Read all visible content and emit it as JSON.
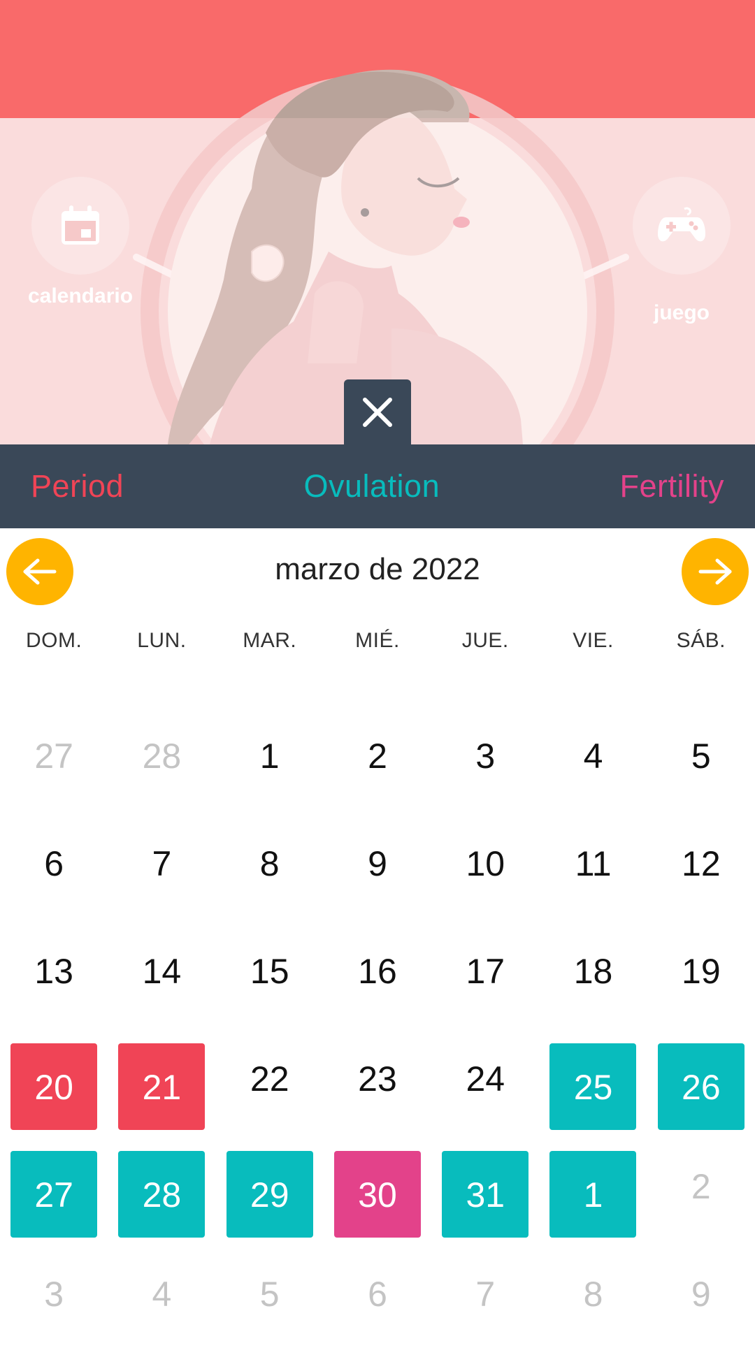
{
  "colors": {
    "header": "#f96a6a",
    "legend_bg": "#3a4858",
    "nav_button": "#ffb400",
    "period": "#f04456",
    "ovulation": "#08bcbd",
    "fertility": "#e3428a"
  },
  "features": {
    "calendar": {
      "label": "calendario",
      "icon": "calendar-icon"
    },
    "game": {
      "label": "juego",
      "icon": "gamepad-icon"
    }
  },
  "legend": {
    "period": "Period",
    "ovulation": "Ovulation",
    "fertility": "Fertility"
  },
  "calendar": {
    "month_title": "marzo de 2022",
    "weekdays": [
      "DOM.",
      "LUN.",
      "MAR.",
      "MIÉ.",
      "JUE.",
      "VIE.",
      "SÁB."
    ],
    "weeks": [
      [
        {
          "d": "27",
          "t": "muted"
        },
        {
          "d": "28",
          "t": "muted"
        },
        {
          "d": "1",
          "t": ""
        },
        {
          "d": "2",
          "t": ""
        },
        {
          "d": "3",
          "t": ""
        },
        {
          "d": "4",
          "t": ""
        },
        {
          "d": "5",
          "t": ""
        }
      ],
      [
        {
          "d": "6",
          "t": ""
        },
        {
          "d": "7",
          "t": ""
        },
        {
          "d": "8",
          "t": ""
        },
        {
          "d": "9",
          "t": ""
        },
        {
          "d": "10",
          "t": ""
        },
        {
          "d": "11",
          "t": ""
        },
        {
          "d": "12",
          "t": ""
        }
      ],
      [
        {
          "d": "13",
          "t": ""
        },
        {
          "d": "14",
          "t": ""
        },
        {
          "d": "15",
          "t": ""
        },
        {
          "d": "16",
          "t": ""
        },
        {
          "d": "17",
          "t": ""
        },
        {
          "d": "18",
          "t": ""
        },
        {
          "d": "19",
          "t": ""
        }
      ],
      [
        {
          "d": "20",
          "t": "period"
        },
        {
          "d": "21",
          "t": "period"
        },
        {
          "d": "22",
          "t": ""
        },
        {
          "d": "23",
          "t": ""
        },
        {
          "d": "24",
          "t": ""
        },
        {
          "d": "25",
          "t": "ovulation"
        },
        {
          "d": "26",
          "t": "ovulation"
        }
      ],
      [
        {
          "d": "27",
          "t": "ovulation"
        },
        {
          "d": "28",
          "t": "ovulation"
        },
        {
          "d": "29",
          "t": "ovulation"
        },
        {
          "d": "30",
          "t": "fertility"
        },
        {
          "d": "31",
          "t": "ovulation"
        },
        {
          "d": "1",
          "t": "ovulation"
        },
        {
          "d": "2",
          "t": "muted"
        }
      ],
      [
        {
          "d": "3",
          "t": "muted"
        },
        {
          "d": "4",
          "t": "muted"
        },
        {
          "d": "5",
          "t": "muted"
        },
        {
          "d": "6",
          "t": "muted"
        },
        {
          "d": "7",
          "t": "muted"
        },
        {
          "d": "8",
          "t": "muted"
        },
        {
          "d": "9",
          "t": "muted"
        }
      ]
    ]
  }
}
